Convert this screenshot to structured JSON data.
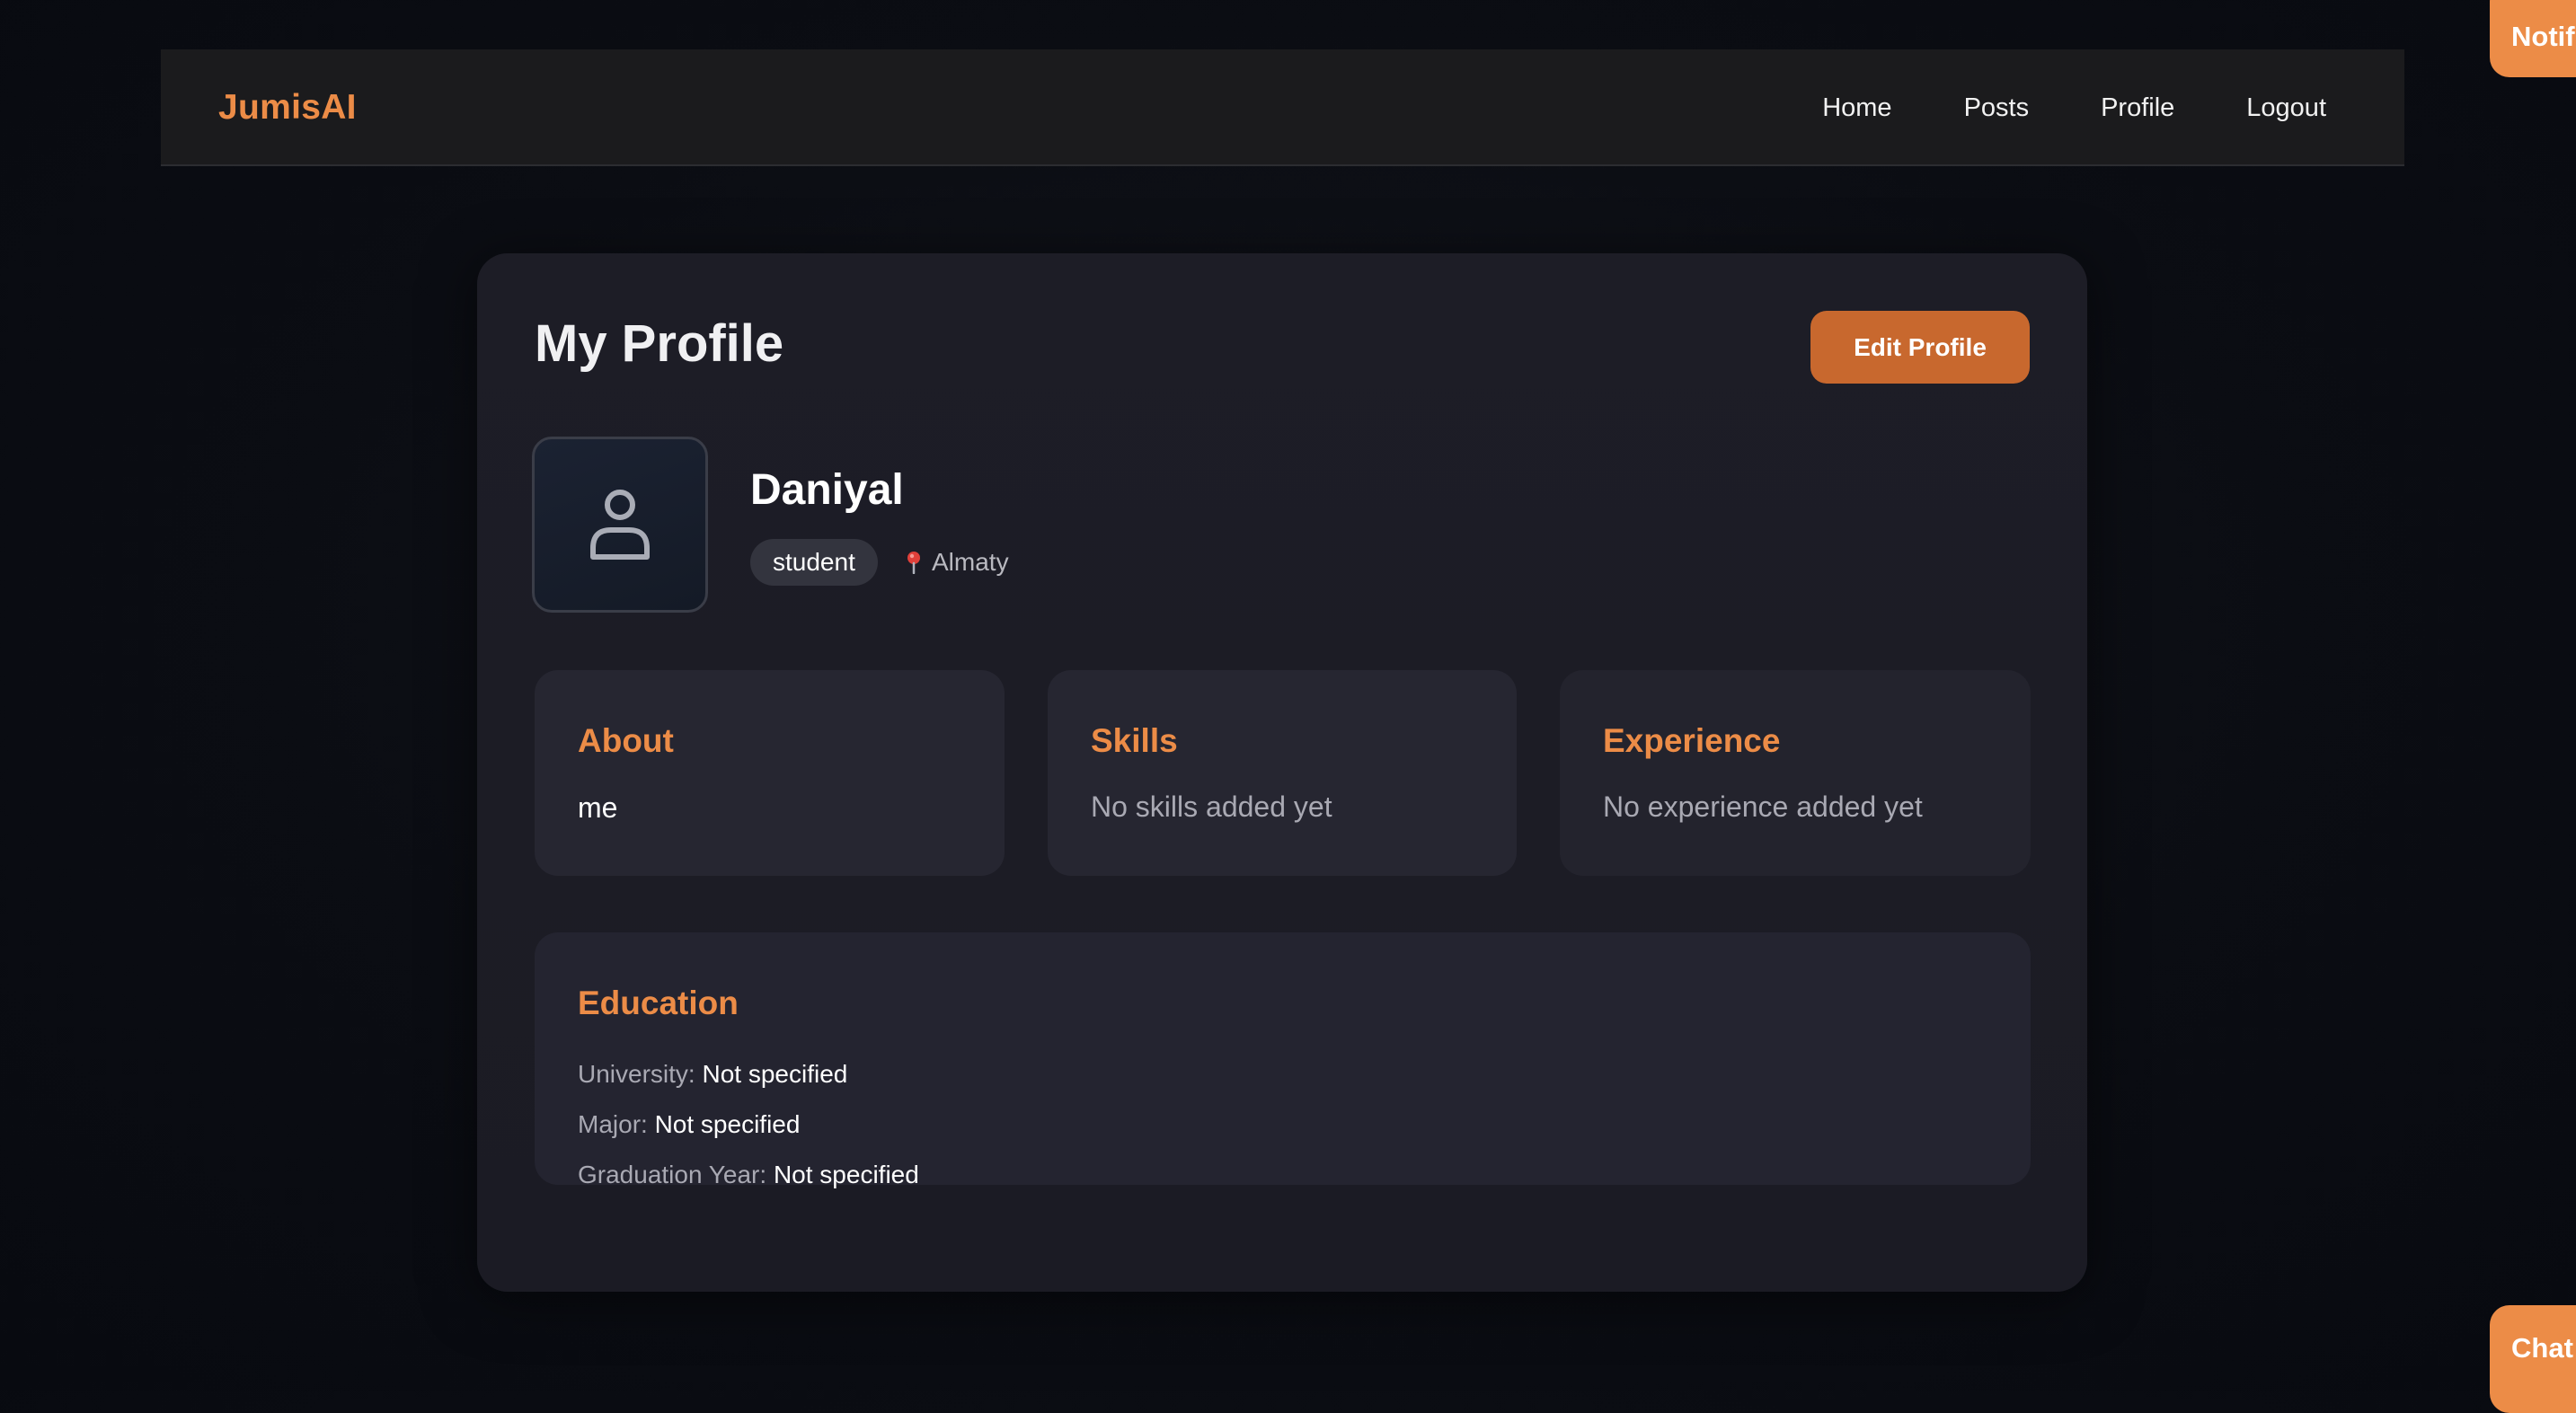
{
  "nav": {
    "brand": "JumisAI",
    "links": [
      "Home",
      "Posts",
      "Profile",
      "Logout"
    ]
  },
  "profile": {
    "title": "My Profile",
    "edit_button": "Edit Profile",
    "avatar_icon": "user-icon",
    "name": "Daniyal",
    "role": "student",
    "location_icon": "pin-icon",
    "location": "Almaty"
  },
  "sections": {
    "about": {
      "title": "About",
      "text": "me"
    },
    "skills": {
      "title": "Skills",
      "text": "No skills added yet"
    },
    "experience": {
      "title": "Experience",
      "text": "No experience added yet"
    }
  },
  "education": {
    "title": "Education",
    "rows": [
      {
        "label": "University:",
        "value": "Not specified"
      },
      {
        "label": "Major:",
        "value": "Not specified"
      },
      {
        "label": "Graduation Year:",
        "value": "Not specified"
      }
    ]
  },
  "floating": {
    "notifications": "Notif",
    "chat": "Chat"
  },
  "colors": {
    "accent": "#ec8c47",
    "button": "#c8682e",
    "card": "#1d1d26",
    "navbar": "#1b1b1d"
  }
}
